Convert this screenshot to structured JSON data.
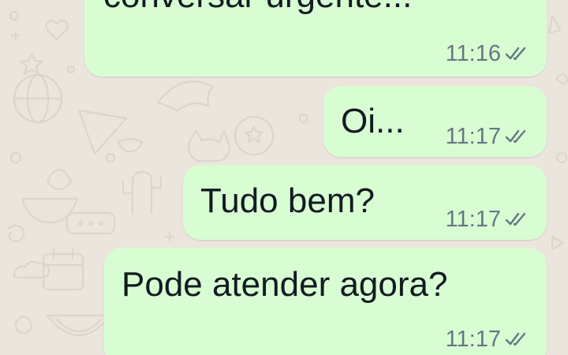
{
  "colors": {
    "wallpaper": "#ece5dd",
    "outgoing_bubble": "#d9fdd3",
    "message_text": "#111b21",
    "meta_text": "#667781"
  },
  "messages": [
    {
      "text": "conversar urgente...",
      "time": "11:16",
      "status_icon": "double-check-icon"
    },
    {
      "text": "Oi...",
      "time": "11:17",
      "status_icon": "double-check-icon"
    },
    {
      "text": "Tudo bem?",
      "time": "11:17",
      "status_icon": "double-check-icon"
    },
    {
      "text": "Pode atender agora?",
      "time": "11:17",
      "status_icon": "double-check-icon"
    }
  ]
}
